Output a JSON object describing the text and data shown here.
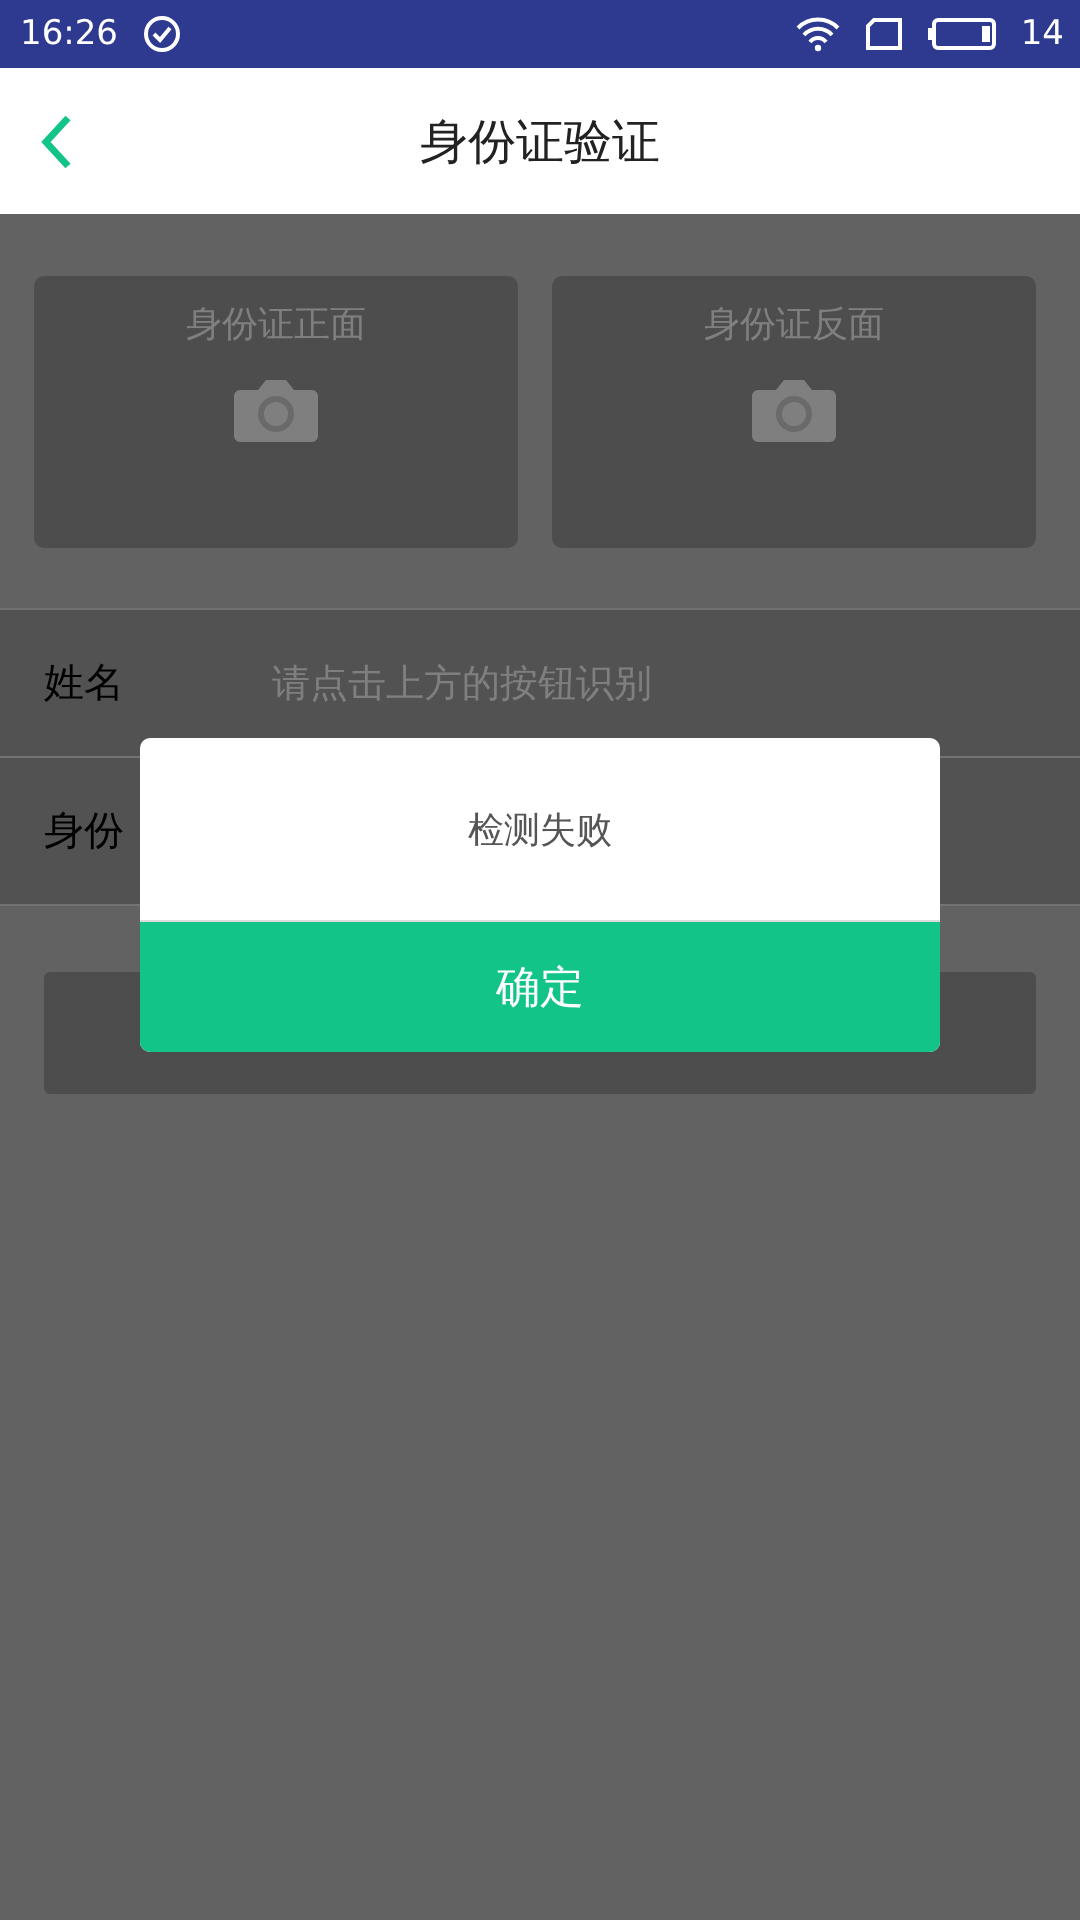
{
  "status_bar": {
    "time": "16:26",
    "battery": "14"
  },
  "header": {
    "title": "身份证验证"
  },
  "id_cards": [
    {
      "label": "身份证正面"
    },
    {
      "label": "身份证反面"
    }
  ],
  "form": {
    "rows": [
      {
        "label": "姓名",
        "placeholder": "请点击上方的按钮识别"
      },
      {
        "label": "身份"
      }
    ]
  },
  "dialog": {
    "message": "检测失败",
    "confirm": "确定"
  }
}
